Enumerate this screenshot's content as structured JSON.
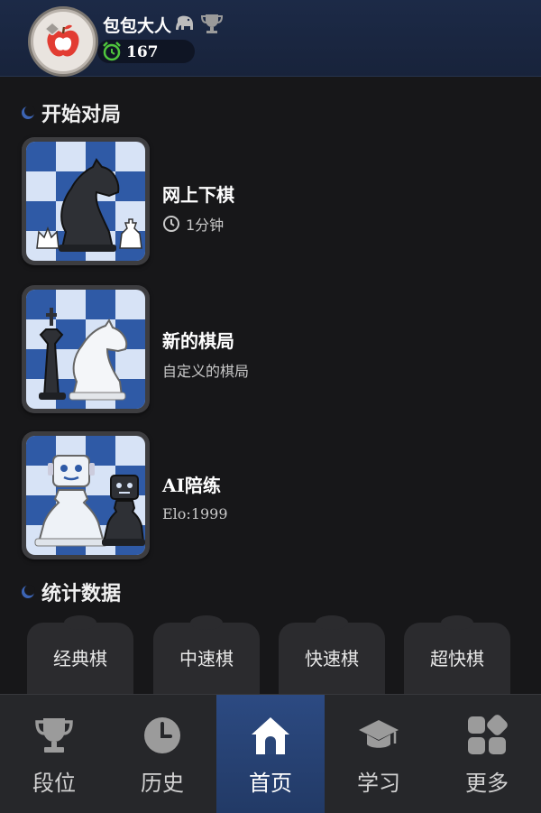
{
  "header": {
    "username": "包包大人",
    "rating": "167"
  },
  "sections": {
    "play_title": "开始对局",
    "stats_title": "统计数据"
  },
  "modes": [
    {
      "title": "网上下棋",
      "subtitle": "1分钟",
      "icon": "knight-online-icon"
    },
    {
      "title": "新的棋局",
      "subtitle": "自定义的棋局",
      "icon": "king-knight-icon"
    },
    {
      "title": "AI陪练",
      "subtitle": "Elo:1999",
      "icon": "robot-pawn-icon"
    }
  ],
  "stats": [
    {
      "label": "经典棋"
    },
    {
      "label": "中速棋"
    },
    {
      "label": "快速棋"
    },
    {
      "label": "超快棋"
    }
  ],
  "tabs": [
    {
      "label": "段位",
      "icon": "trophy-icon",
      "active": false
    },
    {
      "label": "历史",
      "icon": "clock-icon",
      "active": false
    },
    {
      "label": "首页",
      "icon": "home-icon",
      "active": true
    },
    {
      "label": "学习",
      "icon": "graduation-cap-icon",
      "active": false
    },
    {
      "label": "更多",
      "icon": "grid-icon",
      "active": false
    }
  ],
  "colors": {
    "accent": "#2c4a82",
    "board_dark": "#2f5aa6",
    "board_light": "#d7e3f6",
    "rating_clock": "#4fc53d"
  }
}
